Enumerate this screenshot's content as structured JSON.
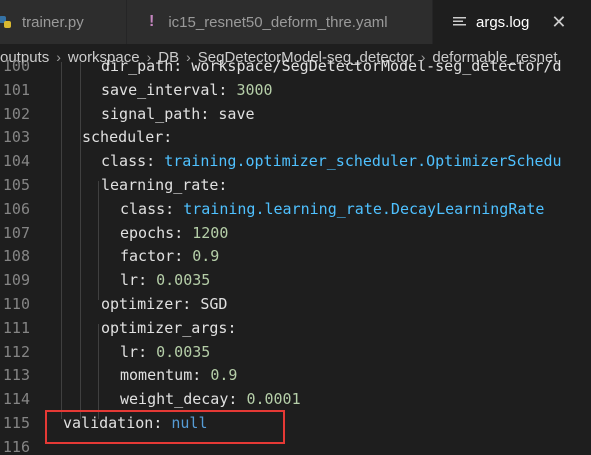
{
  "tabs": [
    {
      "label": "trainer.py",
      "icon": "python-file-icon",
      "active": false
    },
    {
      "label": "ic15_resnet50_deform_thre.yaml",
      "icon": "yaml-exclamation-icon",
      "active": false
    },
    {
      "label": "args.log",
      "icon": "log-lines-icon",
      "active": true,
      "close": "✕"
    }
  ],
  "breadcrumb": [
    "outputs",
    "workspace",
    "DB",
    "SegDetectorModel-seg_detector",
    "deformable_resnet"
  ],
  "breadcrumb_sep": "›",
  "lines": [
    {
      "num": "100",
      "key": "dir_path",
      "sep": ": ",
      "value": "workspace/SegDetectorModel-seg_detector/d",
      "vtype": "str"
    },
    {
      "num": "101",
      "key": "save_interval",
      "sep": ": ",
      "value": "3000",
      "vtype": "num"
    },
    {
      "num": "102",
      "key": "signal_path",
      "sep": ": ",
      "value": "save",
      "vtype": "str"
    },
    {
      "num": "103",
      "key": "scheduler",
      "sep": ":",
      "value": "",
      "vtype": "str"
    },
    {
      "num": "104",
      "key": "class",
      "sep": ": ",
      "value": "training.optimizer_scheduler.OptimizerSchedu",
      "vtype": "cls"
    },
    {
      "num": "105",
      "key": "learning_rate",
      "sep": ":",
      "value": "",
      "vtype": "str"
    },
    {
      "num": "106",
      "key": "class",
      "sep": ": ",
      "value": "training.learning_rate.DecayLearningRate",
      "vtype": "cls"
    },
    {
      "num": "107",
      "key": "epochs",
      "sep": ": ",
      "value": "1200",
      "vtype": "num"
    },
    {
      "num": "108",
      "key": "factor",
      "sep": ": ",
      "value": "0.9",
      "vtype": "num"
    },
    {
      "num": "109",
      "key": "lr",
      "sep": ": ",
      "value": "0.0035",
      "vtype": "num"
    },
    {
      "num": "110",
      "key": "optimizer",
      "sep": ": ",
      "value": "SGD",
      "vtype": "str"
    },
    {
      "num": "111",
      "key": "optimizer_args",
      "sep": ":",
      "value": "",
      "vtype": "str"
    },
    {
      "num": "112",
      "key": "lr",
      "sep": ": ",
      "value": "0.0035",
      "vtype": "num"
    },
    {
      "num": "113",
      "key": "momentum",
      "sep": ": ",
      "value": "0.9",
      "vtype": "num"
    },
    {
      "num": "114",
      "key": "weight_decay",
      "sep": ": ",
      "value": "0.0001",
      "vtype": "num"
    },
    {
      "num": "115",
      "key": "validation",
      "sep": ": ",
      "value": "null",
      "vtype": "null"
    },
    {
      "num": "116",
      "key": "",
      "sep": "",
      "value": "",
      "vtype": "str"
    }
  ],
  "colors": {
    "highlight_box": "#e53935",
    "class_value": "#4fc1ff",
    "number_value": "#b5cea8",
    "null_value": "#569cd6"
  }
}
